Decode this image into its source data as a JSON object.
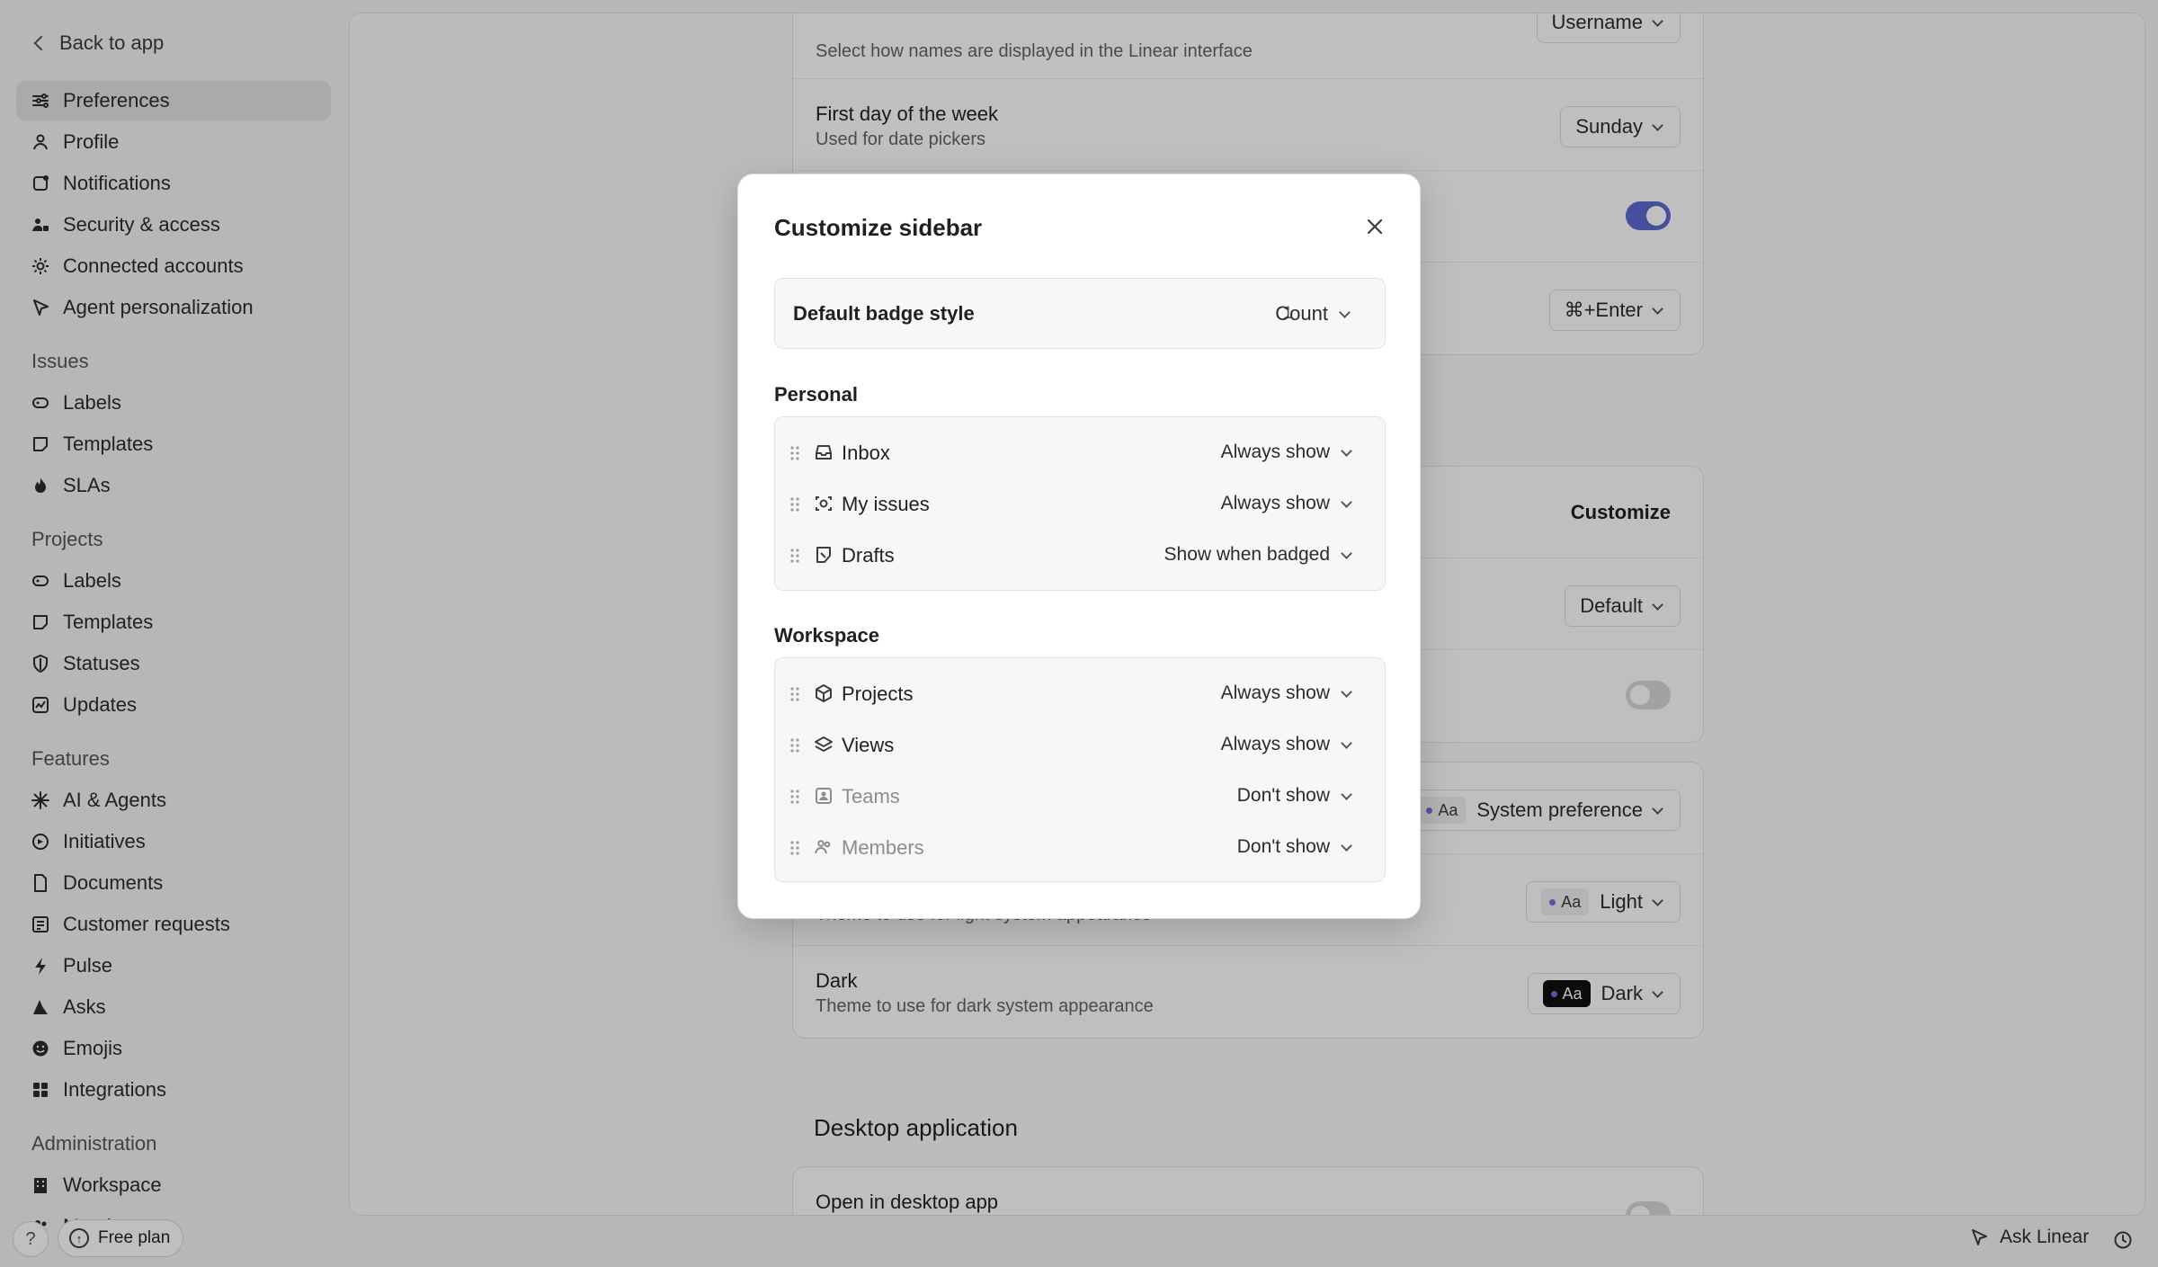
{
  "sidebar": {
    "back_label": "Back to app",
    "account": [
      {
        "label": "Preferences",
        "icon": "sliders-icon",
        "active": true
      },
      {
        "label": "Profile",
        "icon": "person-icon"
      },
      {
        "label": "Notifications",
        "icon": "notification-icon"
      },
      {
        "label": "Security & access",
        "icon": "users-lock-icon"
      },
      {
        "label": "Connected accounts",
        "icon": "gear-icon"
      },
      {
        "label": "Agent personalization",
        "icon": "cursor-icon"
      }
    ],
    "issues_title": "Issues",
    "issues": [
      {
        "label": "Labels",
        "icon": "tag-icon"
      },
      {
        "label": "Templates",
        "icon": "template-icon"
      },
      {
        "label": "SLAs",
        "icon": "flame-icon"
      }
    ],
    "projects_title": "Projects",
    "projects": [
      {
        "label": "Labels",
        "icon": "tag-icon"
      },
      {
        "label": "Templates",
        "icon": "template-icon"
      },
      {
        "label": "Statuses",
        "icon": "shield-icon"
      },
      {
        "label": "Updates",
        "icon": "chart-icon"
      }
    ],
    "features_title": "Features",
    "features": [
      {
        "label": "AI & Agents",
        "icon": "sparkle-icon"
      },
      {
        "label": "Initiatives",
        "icon": "initiative-icon"
      },
      {
        "label": "Documents",
        "icon": "document-icon"
      },
      {
        "label": "Customer requests",
        "icon": "request-icon"
      },
      {
        "label": "Pulse",
        "icon": "pulse-icon"
      },
      {
        "label": "Asks",
        "icon": "asks-icon"
      },
      {
        "label": "Emojis",
        "icon": "emoji-icon"
      },
      {
        "label": "Integrations",
        "icon": "grid-icon"
      }
    ],
    "admin_title": "Administration",
    "admin": [
      {
        "label": "Workspace",
        "icon": "building-icon"
      },
      {
        "label": "Members",
        "icon": "members-icon"
      }
    ]
  },
  "background": {
    "display_names_subtitle": "Select how names are displayed in the Linear interface",
    "display_names_value": "Username",
    "first_day_title": "First day of the week",
    "first_day_subtitle": "Used for date pickers",
    "first_day_value": "Sunday",
    "send_shortcut_value": "⌘+Enter",
    "customize_label": "Customize",
    "default_value": "Default",
    "partial_s": "s",
    "interface_theme_value": "System preference",
    "light_subtitle": "Theme to use for light system appearance",
    "light_value": "Light",
    "dark_title": "Dark",
    "dark_subtitle": "Theme to use for dark system appearance",
    "dark_value": "Dark",
    "aa": "Aa",
    "desktop_section": "Desktop application",
    "open_desktop_title": "Open in desktop app"
  },
  "modal": {
    "title": "Customize sidebar",
    "badge_label": "Default badge style",
    "badge_count": "1",
    "badge_value": "Count",
    "personal_title": "Personal",
    "personal": [
      {
        "name": "Inbox",
        "icon": "inbox-icon",
        "option": "Always show",
        "muted": false
      },
      {
        "name": "My issues",
        "icon": "target-icon",
        "option": "Always show",
        "muted": false
      },
      {
        "name": "Drafts",
        "icon": "draft-icon",
        "option": "Show when badged",
        "muted": false
      }
    ],
    "workspace_title": "Workspace",
    "workspace": [
      {
        "name": "Projects",
        "icon": "cube-icon",
        "option": "Always show",
        "muted": false
      },
      {
        "name": "Views",
        "icon": "layers-icon",
        "option": "Always show",
        "muted": false
      },
      {
        "name": "Teams",
        "icon": "team-icon",
        "option": "Don't show",
        "muted": true
      },
      {
        "name": "Members",
        "icon": "members-icon",
        "option": "Don't show",
        "muted": true
      }
    ]
  },
  "bottom": {
    "help": "?",
    "plan_label": "Free plan",
    "ask_label": "Ask Linear"
  },
  "colors": {
    "accent": "#5e6ad2",
    "overlay": "rgba(0,0,0,0.25)"
  }
}
